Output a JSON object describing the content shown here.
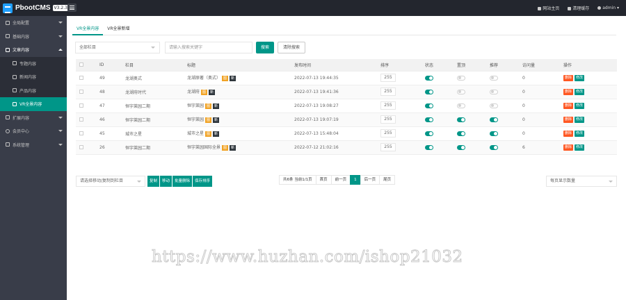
{
  "app": {
    "name": "PbootCMS",
    "version": "V3.2.3"
  },
  "topbar": {
    "site_home": "网站主页",
    "clear_cache": "清理缓存",
    "user": "admin"
  },
  "sidebar": {
    "items": [
      {
        "label": "全局配置",
        "icon": "gear-icon"
      },
      {
        "label": "基础内容",
        "icon": "sliders-icon"
      },
      {
        "label": "文章内容",
        "icon": "document-icon"
      },
      {
        "label": "专题内容",
        "icon": "file-icon"
      },
      {
        "label": "新闻内容",
        "icon": "file-icon"
      },
      {
        "label": "产品内容",
        "icon": "file-icon"
      },
      {
        "label": "VR全景内容",
        "icon": "file-icon"
      },
      {
        "label": "扩展内容",
        "icon": "cube-icon"
      },
      {
        "label": "会员中心",
        "icon": "user-icon"
      },
      {
        "label": "系统管理",
        "icon": "settings-icon"
      }
    ]
  },
  "tabs": [
    "VR全景内容",
    "VR全景新增"
  ],
  "filter": {
    "column_select": "全部栏目",
    "search_placeholder": "请输入搜索关键字",
    "search_btn": "搜索",
    "clear_btn": "清除搜索"
  },
  "table": {
    "headers": [
      "",
      "ID",
      "栏目",
      "标题",
      "发布时间",
      "排序",
      "状态",
      "置顶",
      "推荐",
      "访问量",
      "操作"
    ],
    "rows": [
      {
        "id": "49",
        "column": "龙湖奥式",
        "title": "龙湖原著（奥式）",
        "time": "2022-07-13 19:44:35",
        "sort": "255",
        "status": true,
        "top": false,
        "rec": false,
        "views": "0"
      },
      {
        "id": "48",
        "column": "龙湖府时代",
        "title": "龙湖府",
        "time": "2022-07-13 19:41:36",
        "sort": "255",
        "status": true,
        "top": false,
        "rec": false,
        "views": "0"
      },
      {
        "id": "47",
        "column": "恒宇莱园二期",
        "title": "恒宇莱园",
        "time": "2022-07-13 19:08:27",
        "sort": "255",
        "status": true,
        "top": false,
        "rec": false,
        "views": "0"
      },
      {
        "id": "46",
        "column": "恒宇莱园二期",
        "title": "恒宇莱园",
        "time": "2022-07-13 19:07:19",
        "sort": "255",
        "status": true,
        "top": true,
        "rec": true,
        "views": "0"
      },
      {
        "id": "45",
        "column": "城市之星",
        "title": "城市之星",
        "time": "2022-07-13 15:48:04",
        "sort": "255",
        "status": true,
        "top": true,
        "rec": true,
        "views": "0"
      },
      {
        "id": "26",
        "column": "恒宇莱园二期",
        "title": "恒宇莱园国际全景",
        "time": "2022-07-12 21:02:16",
        "sort": "255",
        "status": true,
        "top": true,
        "rec": true,
        "views": "6"
      }
    ],
    "tag_img": "图",
    "tag_new": "新",
    "del_label": "删除",
    "edit_label": "修改"
  },
  "bottom": {
    "batch_select": "请选择移动/复制到栏目",
    "btn_copy": "复制",
    "btn_move": "移动",
    "btn_batch_delete": "批量删除",
    "btn_save_sort": "保存排序",
    "page_size": "每页显示数量"
  },
  "pager": {
    "info": "共6条 当前1/1页",
    "first": "首页",
    "prev": "前一页",
    "current": "1",
    "next": "后一页",
    "last": "尾页"
  },
  "watermark": "https://www.huzhan.com/ishop21032",
  "colors": {
    "accent": "#009688",
    "danger": "#ff5722",
    "sidebar": "#393d49",
    "topbar": "#23262e"
  }
}
